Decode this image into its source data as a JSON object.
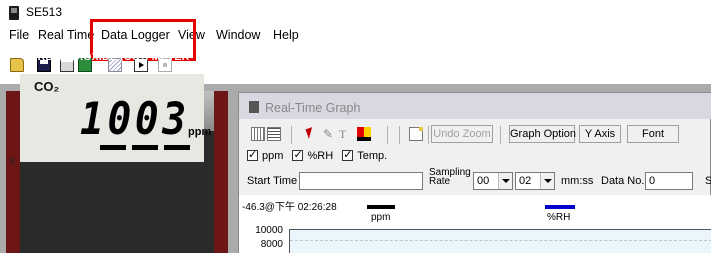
{
  "app": {
    "title": "SE513"
  },
  "menu": {
    "items": [
      "File",
      "Real Time",
      "Data Logger",
      "View",
      "Window",
      "Help"
    ]
  },
  "toolbar": {
    "icons": [
      "open-icon",
      "save-icon",
      "print-icon",
      "export-icon",
      "chart-icon",
      "play-icon",
      "stop-icon"
    ]
  },
  "meter": {
    "label": "CARBON DIOXIDE (CO₂) METER",
    "co2_label": "CO₂",
    "value": "1003",
    "unit": "ppm",
    "side_mark": "K"
  },
  "graph_window": {
    "title": "Real-Time Graph",
    "buttons": {
      "undo_zoom": "Undo Zoom",
      "graph_option": "Graph Option",
      "y_axis": "Y Axis",
      "font": "Font"
    },
    "checkboxes": [
      {
        "label": "ppm",
        "checked": true
      },
      {
        "label": "%RH",
        "checked": true
      },
      {
        "label": "Temp.",
        "checked": true
      }
    ],
    "start_time_label": "Start Time",
    "start_time_value": "",
    "sampling_rate_label_1": "Sampling",
    "sampling_rate_label_2": "Rate",
    "sampling_min": "00",
    "sampling_sec": "02",
    "sampling_unit": "mm:ss",
    "data_no_label": "Data No.",
    "data_no_value": "0",
    "right_cut_label": "S",
    "timestamp": "-46.3@下午 02:26:28",
    "legend": [
      {
        "name": "ppm",
        "color": "#000000"
      },
      {
        "name": "%RH",
        "color": "#0000cc"
      }
    ],
    "y_ticks": [
      "10000",
      "8000"
    ]
  },
  "colors": {
    "highlight": "#e60000",
    "meter_case": "#6e1515"
  }
}
